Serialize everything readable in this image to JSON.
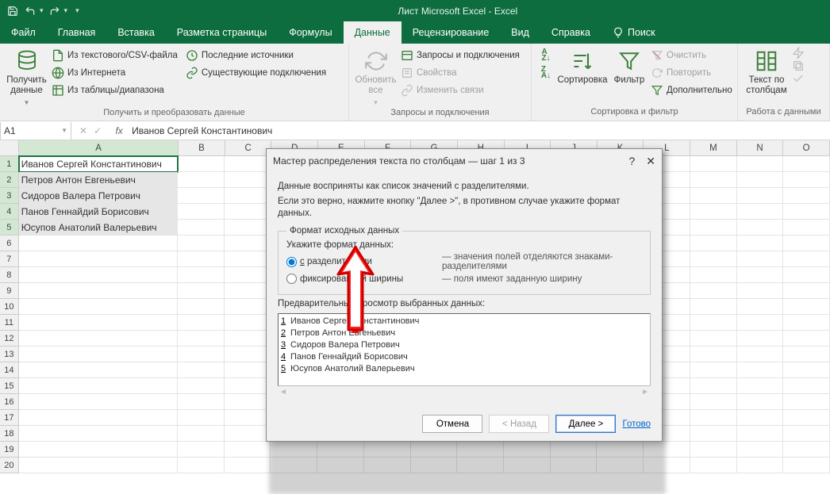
{
  "app": {
    "title": "Лист Microsoft Excel  -  Excel"
  },
  "qat": {
    "save_tip": "save",
    "undo_tip": "undo",
    "redo_tip": "redo"
  },
  "tabs": {
    "file": "Файл",
    "home": "Главная",
    "insert": "Вставка",
    "layout": "Разметка страницы",
    "formulas": "Формулы",
    "data": "Данные",
    "review": "Рецензирование",
    "view": "Вид",
    "help": "Справка",
    "tell": "Поиск"
  },
  "ribbon": {
    "get_data": "Получить данные",
    "from_csv": "Из текстового/CSV-файла",
    "from_web": "Из Интернета",
    "from_table": "Из таблицы/диапазона",
    "recent": "Последние источники",
    "existing": "Существующие подключения",
    "group1": "Получить и преобразовать данные",
    "refresh": "Обновить все",
    "queries": "Запросы и подключения",
    "props": "Свойства",
    "editlinks": "Изменить связи",
    "group2": "Запросы и подключения",
    "sortAZ": "A→Z",
    "sortZA": "Z→A",
    "sort": "Сортировка",
    "filter": "Фильтр",
    "clear": "Очистить",
    "reapply": "Повторить",
    "advanced": "Дополнительно",
    "group3": "Сортировка и фильтр",
    "text_to_cols": "Текст по столбцам",
    "group4": "Работа с данными"
  },
  "formula_bar": {
    "namebox": "A1",
    "value": "Иванов Сергей Константинович"
  },
  "grid": {
    "col_a_width": 220,
    "std_width": 64,
    "cols": [
      "A",
      "B",
      "C",
      "D",
      "E",
      "F",
      "G",
      "H",
      "I",
      "J",
      "K",
      "L",
      "M",
      "N",
      "O"
    ],
    "rows": [
      "Иванов Сергей Константинович",
      "Петров Антон Евгеньевич",
      "Сидоров Валера Петрович",
      "Панов Геннайдий Борисович",
      "Юсупов Анатолий Валерьевич"
    ],
    "row_count_visible": 20
  },
  "dialog": {
    "title": "Мастер распределения текста по столбцам — шаг 1 из 3",
    "intro1": "Данные восприняты как список значений с разделителями.",
    "intro2": "Если это верно, нажмите кнопку \"Далее >\", в противном случае укажите формат данных.",
    "fieldset_legend": "Формат исходных данных",
    "prompt": "Укажите формат данных:",
    "opt1_label": "с разделителями",
    "opt1_desc": "— значения полей отделяются знаками-разделителями",
    "opt2_label": "фиксированной ширины",
    "opt2_desc": "— поля имеют заданную ширину",
    "preview_label": "Предварительный просмотр выбранных данных:",
    "preview_lines": [
      "Иванов Сергей Константинович",
      "Петров Антон Евгеньевич",
      "Сидоров Валера Петрович",
      "Панов Геннайдий Борисович",
      "Юсупов Анатолий Валерьевич"
    ],
    "btn_cancel": "Отмена",
    "btn_back": "< Назад",
    "btn_next": "Далее >",
    "btn_finish": "Готово"
  }
}
